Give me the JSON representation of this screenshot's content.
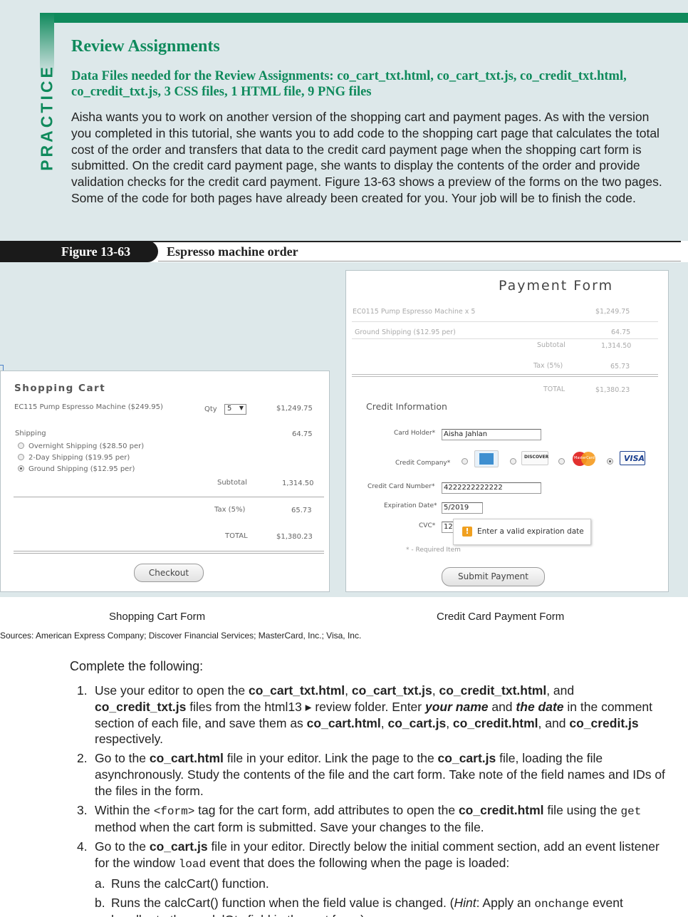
{
  "side_tab": "PRACTICE",
  "section_title": "Review Assignments",
  "data_files": "Data Files needed for the Review Assignments: co_cart_txt.html, co_cart_txt.js, co_credit_txt.html, co_credit_txt.js, 3 CSS files, 1 HTML file, 9 PNG files",
  "intro": "Aisha wants you to work on another version of the shopping cart and payment pages. As with the version you completed in this tutorial, she wants you to add code to the shopping cart page that calculates the total cost of the order and transfers that data to the credit card payment page when the shopping cart form is submitted. On the credit card payment page, she wants to display the contents of the order and provide validation checks for the credit card payment. Figure 13-63 shows a preview of the forms on the two pages. Some of the code for both pages have already been created for you. Your job will be to finish the code.",
  "figure": {
    "label": "Figure 13-63",
    "title": "Espresso machine order",
    "cart": {
      "title": "Shopping Cart",
      "item": "EC115 Pump Espresso Machine ($249.95)",
      "qty_label": "Qty",
      "qty_value": "5",
      "item_total": "$1,249.75",
      "shipping_label": "Shipping",
      "shipping_total": "64.75",
      "options": [
        "Overnight Shipping ($28.50 per)",
        "2-Day Shipping ($19.95 per)",
        "Ground Shipping ($12.95 per)"
      ],
      "subtotal_label": "Subtotal",
      "subtotal": "1,314.50",
      "tax_label": "Tax (5%)",
      "tax": "65.73",
      "total_label": "TOTAL",
      "total": "$1,380.23",
      "checkout": "Checkout"
    },
    "payment": {
      "title": "Payment Form",
      "item": "EC0115 Pump Espresso Machine x 5",
      "item_total": "$1,249.75",
      "shipping": "Ground Shipping ($12.95 per)",
      "shipping_total": "64.75",
      "subtotal_label": "Subtotal",
      "subtotal": "1,314.50",
      "tax_label": "Tax (5%)",
      "tax": "65.73",
      "total_label": "TOTAL",
      "total": "$1,380.23",
      "credit_heading": "Credit Information",
      "holder_label": "Card Holder*",
      "holder_value": "Aisha Jahlan",
      "company_label": "Credit Company*",
      "discover": "DISCOVER",
      "mastercard": "MasterCard",
      "visa": "VISA",
      "number_label": "Credit Card Number*",
      "number_value": "4222222222222",
      "exp_label": "Expiration Date*",
      "exp_value": "5/2019",
      "cvc_label": "CVC*",
      "cvc_value": "123",
      "tooltip": "Enter a valid expiration date",
      "required": "* - Required Item",
      "submit": "Submit Payment"
    },
    "caption_left": "Shopping Cart Form",
    "caption_right": "Credit Card Payment Form",
    "sources": "Sources: American Express Company; Discover Financial Services; MasterCard, Inc.; Visa, Inc."
  },
  "complete_heading": "Complete the following:",
  "steps": {
    "s1": {
      "num": "1.",
      "a": "Use your editor to open the ",
      "f1": "co_cart_txt.html",
      "c1": ", ",
      "f2": "co_cart_txt.js",
      "c2": ", ",
      "f3": "co_credit_txt.html",
      "c3": ", and ",
      "f4": "co_credit_txt.js",
      "b": " files from the html13 ▸ review folder. Enter ",
      "name": "your name",
      "c": " and ",
      "date": "the date",
      "d": " in the comment section of each file, and save them as ",
      "g1": "co_cart.html",
      "c4": ", ",
      "g2": "co_cart.js",
      "c5": ", ",
      "g3": "co_credit.html",
      "c6": ", and ",
      "g4": "co_credit.js",
      "e": " respectively."
    },
    "s2": {
      "num": "2.",
      "a": "Go to the ",
      "f1": "co_cart.html",
      "b": " file in your editor. Link the page to the ",
      "f2": "co_cart.js",
      "c": " file, loading the file asynchronously. Study the contents of the file and the cart form. Take note of the field names and IDs of the files in the form."
    },
    "s3": {
      "num": "3.",
      "a": "Within the ",
      "tag": "<form>",
      "b": " tag for the cart form, add attributes to open the ",
      "f1": "co_credit.html",
      "c": " file using the ",
      "get": "get",
      "d": " method when the cart form is submitted. Save your changes to the file."
    },
    "s4": {
      "num": "4.",
      "a": "Go to the ",
      "f1": "co_cart.js",
      "b": " file in your editor. Directly below the initial comment section, add an event listener for the window ",
      "load": "load",
      "c": " event that does the following when the page is loaded:"
    },
    "s4a": {
      "num": "a.",
      "text": "Runs the calcCart() function."
    },
    "s4b": {
      "num": "b.",
      "a": "Runs the calcCart() function when the field value is changed. (",
      "hint": "Hint",
      "b": ": Apply an ",
      "code": "onchange",
      "c": " event handler to the modelQty field in the cart form.)"
    }
  }
}
